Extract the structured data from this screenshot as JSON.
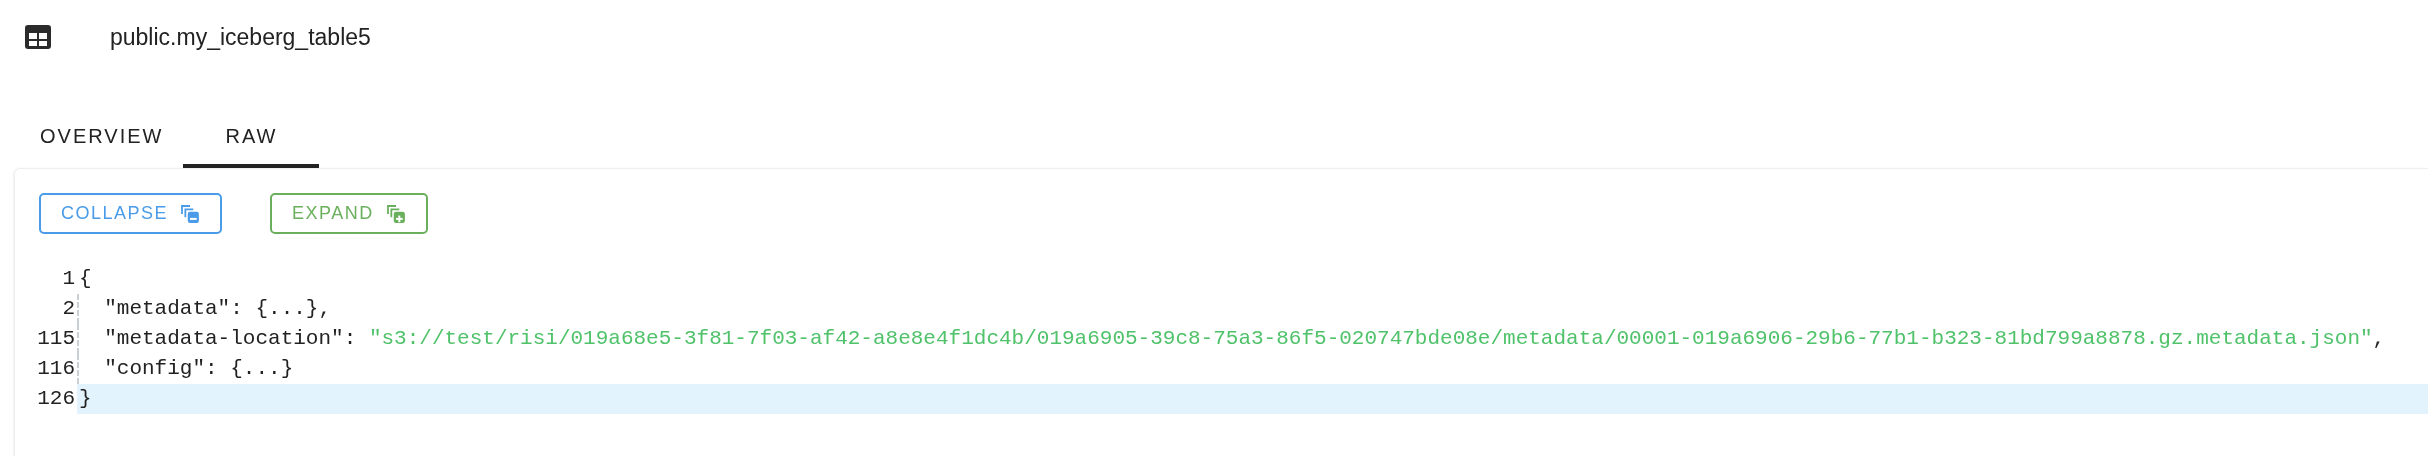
{
  "header": {
    "title": "public.my_iceberg_table5"
  },
  "tabs": [
    {
      "label": "OVERVIEW",
      "selected": false
    },
    {
      "label": "RAW",
      "selected": true
    }
  ],
  "buttons": [
    {
      "label": "COLLAPSE",
      "kind": "collapse"
    },
    {
      "label": "EXPAND",
      "kind": "expand"
    }
  ],
  "code_lines": [
    {
      "number": "1",
      "active": false,
      "tokens": [
        {
          "kind": "punct",
          "text": "{"
        }
      ]
    },
    {
      "number": "2",
      "active": false,
      "tokens": [
        {
          "kind": "key",
          "text": "  \"metadata\""
        },
        {
          "kind": "punct",
          "text": ": {...},"
        }
      ]
    },
    {
      "number": "115",
      "active": false,
      "tokens": [
        {
          "kind": "key",
          "text": "  \"metadata-location\""
        },
        {
          "kind": "punct",
          "text": ": "
        },
        {
          "kind": "string",
          "text": "\"s3://test/risi/019a68e5-3f81-7f03-af42-a8e8e4f1dc4b/019a6905-39c8-75a3-86f5-020747bde08e/metadata/00001-019a6906-29b6-77b1-b323-81bd799a8878.gz.metadata.json\""
        },
        {
          "kind": "punct",
          "text": ","
        }
      ]
    },
    {
      "number": "116",
      "active": false,
      "tokens": [
        {
          "kind": "key",
          "text": "  \"config\""
        },
        {
          "kind": "punct",
          "text": ": {...}"
        }
      ]
    },
    {
      "number": "126",
      "active": true,
      "tokens": [
        {
          "kind": "punct",
          "text": "}"
        }
      ]
    }
  ]
}
